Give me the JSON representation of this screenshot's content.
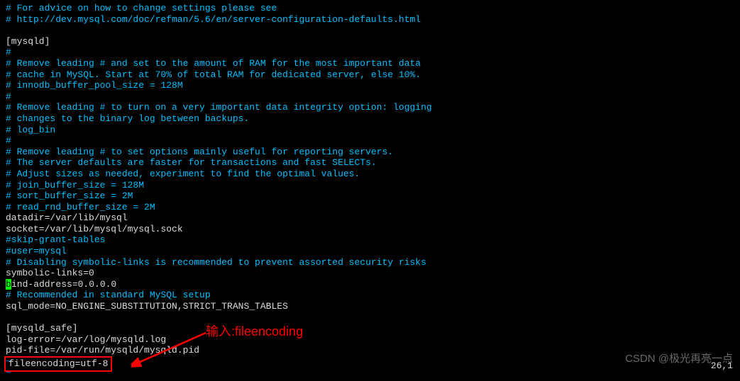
{
  "lines": [
    {
      "style": "comment",
      "text": "# For advice on how to change settings please see"
    },
    {
      "style": "comment",
      "text": "# http://dev.mysql.com/doc/refman/5.6/en/server-configuration-defaults.html"
    },
    {
      "style": "plain",
      "text": ""
    },
    {
      "style": "plain",
      "text": "[mysqld]"
    },
    {
      "style": "comment",
      "text": "#"
    },
    {
      "style": "comment",
      "text": "# Remove leading # and set to the amount of RAM for the most important data"
    },
    {
      "style": "comment",
      "text": "# cache in MySQL. Start at 70% of total RAM for dedicated server, else 10%."
    },
    {
      "style": "comment",
      "text": "# innodb_buffer_pool_size = 128M"
    },
    {
      "style": "comment",
      "text": "#"
    },
    {
      "style": "comment",
      "text": "# Remove leading # to turn on a very important data integrity option: logging"
    },
    {
      "style": "comment",
      "text": "# changes to the binary log between backups."
    },
    {
      "style": "comment",
      "text": "# log_bin"
    },
    {
      "style": "comment",
      "text": "#"
    },
    {
      "style": "comment",
      "text": "# Remove leading # to set options mainly useful for reporting servers."
    },
    {
      "style": "comment",
      "text": "# The server defaults are faster for transactions and fast SELECTs."
    },
    {
      "style": "comment",
      "text": "# Adjust sizes as needed, experiment to find the optimal values."
    },
    {
      "style": "comment",
      "text": "# join_buffer_size = 128M"
    },
    {
      "style": "comment",
      "text": "# sort_buffer_size = 2M"
    },
    {
      "style": "comment",
      "text": "# read_rnd_buffer_size = 2M"
    },
    {
      "style": "plain",
      "text": "datadir=/var/lib/mysql"
    },
    {
      "style": "plain",
      "text": "socket=/var/lib/mysql/mysql.sock"
    },
    {
      "style": "comment",
      "text": "#skip-grant-tables"
    },
    {
      "style": "comment",
      "text": "#user=mysql"
    },
    {
      "style": "comment",
      "text": "# Disabling symbolic-links is recommended to prevent assorted security risks"
    },
    {
      "style": "plain",
      "text": "symbolic-links=0"
    },
    {
      "style": "bind",
      "text": "bind-address=0.0.0.0",
      "prefix": "b",
      "suffix": "ind-address=0.0.0.0"
    },
    {
      "style": "comment",
      "text": "# Recommended in standard MySQL setup"
    },
    {
      "style": "plain",
      "text": "sql_mode=NO_ENGINE_SUBSTITUTION,STRICT_TRANS_TABLES"
    },
    {
      "style": "plain",
      "text": ""
    },
    {
      "style": "plain",
      "text": "[mysqld_safe]"
    },
    {
      "style": "plain",
      "text": "log-error=/var/log/mysqld.log"
    },
    {
      "style": "plain",
      "text": "pid-file=/var/run/mysqld/mysqld.pid"
    },
    {
      "style": "tilde",
      "text": "~"
    },
    {
      "style": "tilde",
      "text": "~"
    }
  ],
  "command": "  fileencoding=utf-8",
  "annotation": "输入:fileencoding",
  "watermark": "CSDN @极光再亮一点",
  "position": "26,1"
}
